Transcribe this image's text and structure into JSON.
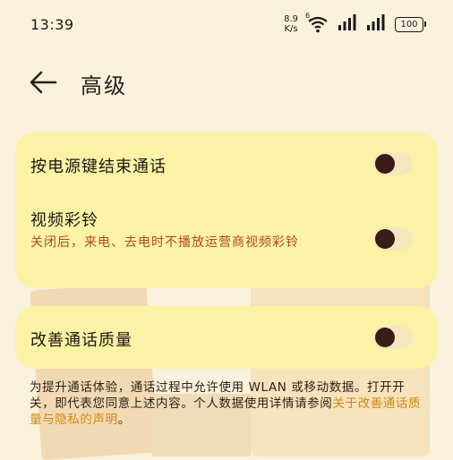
{
  "status_bar": {
    "time": "13:39",
    "net_speed_value": "8.9",
    "net_speed_unit": "K/s",
    "wifi_badge": "6",
    "battery": "100"
  },
  "header": {
    "title": "高级"
  },
  "settings": {
    "power_key_end_call": {
      "title": "按电源键结束通话",
      "enabled": false
    },
    "video_ringtone": {
      "title": "视频彩铃",
      "description": "关闭后，来电、去电时不播放运营商视频彩铃",
      "enabled": false
    },
    "improve_call_quality": {
      "title": "改善通话质量",
      "enabled": false
    }
  },
  "footer_note": {
    "text": "为提升通话体验，通话过程中允许使用 WLAN 或移动数据。打开开关，即代表您同意上述内容。个人数据使用详情请参阅",
    "link_text": "关于改善通话质量与隐私的声明",
    "end_punct": "。"
  },
  "colors": {
    "background": "#f9f1dc",
    "card": "#fbf2a6",
    "link": "#d08a0e",
    "description": "#b04a1a",
    "toggle_knob": "#3a1b18"
  }
}
